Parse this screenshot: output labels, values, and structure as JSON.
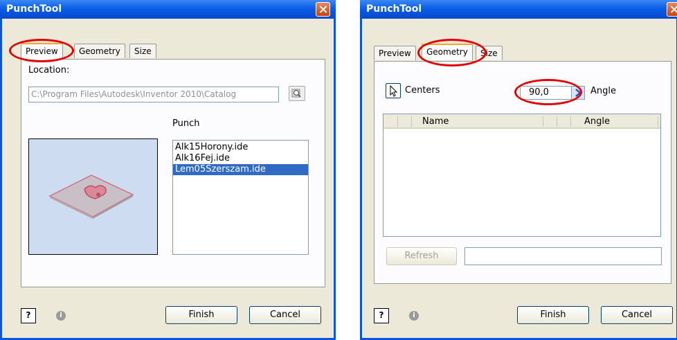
{
  "left_dialog": {
    "title": "PunchTool",
    "tabs": [
      "Preview",
      "Geometry",
      "Size"
    ],
    "location_label": "Location:",
    "location_value": "C:\\Program Files\\Autodesk\\Inventor 2010\\Catalog",
    "browse_icon": "search-icon",
    "punch_label": "Punch",
    "punch_items": [
      "Alk15Horony.ide",
      "Alk16Fej.ide",
      "Lem05Szerszam.ide"
    ],
    "selected_item": "Lem05Szerszam.ide",
    "buttons": {
      "finish": "Finish",
      "cancel": "Cancel"
    }
  },
  "right_dialog": {
    "title": "PunchTool",
    "tabs": [
      "Preview",
      "Geometry",
      "Size"
    ],
    "centers_label": "Centers",
    "angle_value": "90,0",
    "angle_label": "Angle",
    "table_columns": [
      "Name",
      "Angle"
    ],
    "refresh_label": "Refresh",
    "buttons": {
      "finish": "Finish",
      "cancel": "Cancel"
    }
  },
  "colors": {
    "titlebar": "#0a5ee8",
    "dialog_bg": "#ece9d8",
    "selection": "#316ac5",
    "annotation": "#e00000"
  }
}
